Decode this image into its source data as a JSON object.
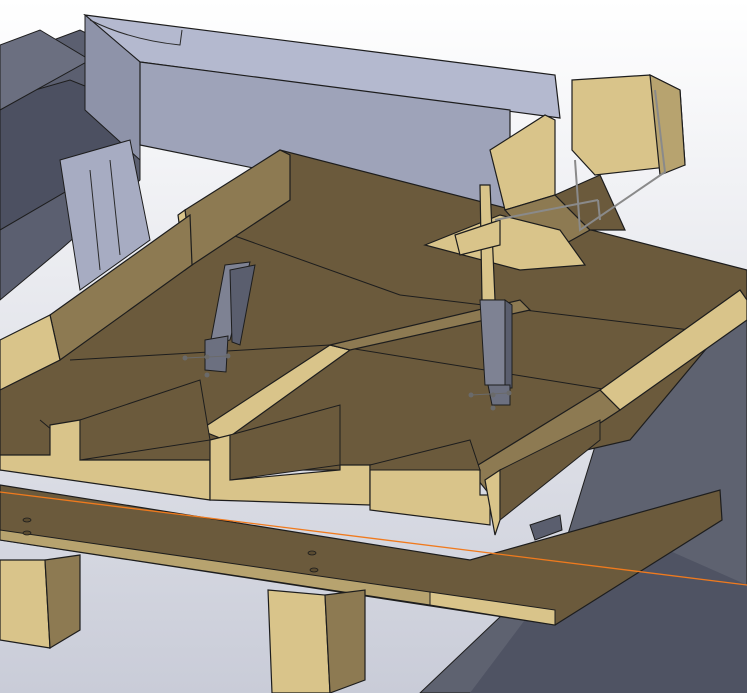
{
  "app": {
    "view_type": "3D CAD model viewport"
  },
  "colors": {
    "background_top": "#ffffff",
    "background_bottom": "#c9ccd8",
    "wood_light": "#d9c48a",
    "wood_dark": "#6b5a3c",
    "wood_mid": "#8d7a52",
    "steel_light": "#b6bbd1",
    "steel_mid": "#8e93a9",
    "steel_dark": "#4f5467",
    "floor_dark": "#5e6270",
    "sketch_line": "#f07a1d",
    "outline": "#1d1d1d",
    "sketch_gray": "#8a8a8a"
  },
  "icons": {
    "sketch_point": "sketch-point-icon"
  }
}
